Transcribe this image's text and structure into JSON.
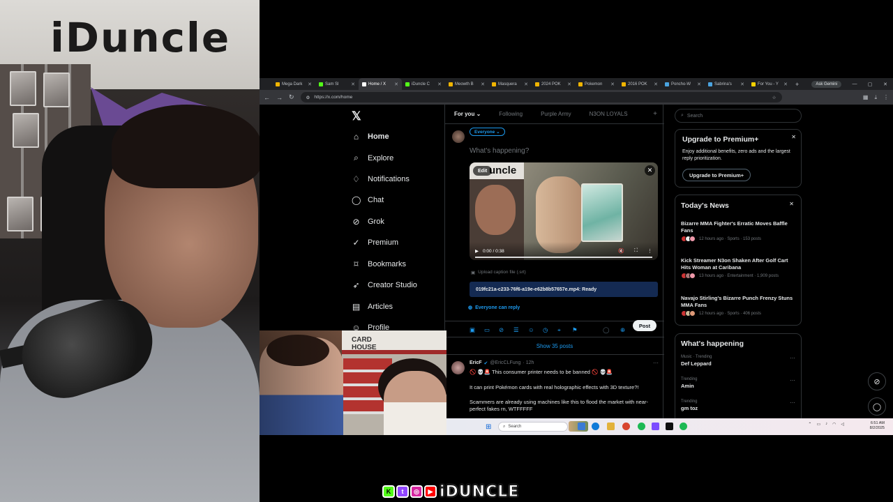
{
  "webcam": {
    "sign_text": "iDuncle"
  },
  "browser": {
    "tabs": [
      {
        "label": "Mega Dark",
        "color": "#f0b400"
      },
      {
        "label": "Sam Sl",
        "color": "#53fc18"
      },
      {
        "label": "Home / X",
        "color": "#ffffff",
        "active": true
      },
      {
        "label": "iDuncle C",
        "color": "#53fc18"
      },
      {
        "label": "Meowth B",
        "color": "#f0b400"
      },
      {
        "label": "Masquera",
        "color": "#f0b400"
      },
      {
        "label": "2024 POK",
        "color": "#f0b400"
      },
      {
        "label": "Pokemon",
        "color": "#f0b400"
      },
      {
        "label": "2016 POK",
        "color": "#f0b400"
      },
      {
        "label": "Poncho-W",
        "color": "#4aa3df"
      },
      {
        "label": "Sabrina's",
        "color": "#4aa3df"
      },
      {
        "label": "For You - Y",
        "color": "#f5d000"
      }
    ],
    "ask_gemini": "Ask Gemini",
    "url": "https://x.com/home"
  },
  "nav": {
    "items": [
      {
        "label": "Home",
        "icon": "home-icon",
        "glyph": "⌂"
      },
      {
        "label": "Explore",
        "icon": "search-icon",
        "glyph": "⌕"
      },
      {
        "label": "Notifications",
        "icon": "bell-icon",
        "glyph": "♢"
      },
      {
        "label": "Chat",
        "icon": "chat-icon",
        "glyph": "◯"
      },
      {
        "label": "Grok",
        "icon": "grok-icon",
        "glyph": "⊘"
      },
      {
        "label": "Premium",
        "icon": "premium-icon",
        "glyph": "✓"
      },
      {
        "label": "Bookmarks",
        "icon": "bookmark-icon",
        "glyph": "⌑"
      },
      {
        "label": "Creator Studio",
        "icon": "rocket-icon",
        "glyph": "➶"
      },
      {
        "label": "Articles",
        "icon": "article-icon",
        "glyph": "▤"
      },
      {
        "label": "Profile",
        "icon": "profile-icon",
        "glyph": "☺"
      }
    ]
  },
  "feed": {
    "tabs": [
      "For you",
      "Following",
      "Purple Army",
      "N3ON LOYALS"
    ],
    "audience": "Everyone",
    "placeholder": "What's happening?",
    "edit": "Edit",
    "video_time": "0:00 / 0:38",
    "caption": "Upload caption file (.srt)",
    "file_status": "019fc21a-c233-76f6-a19e-e62b8b57657e.mp4: Ready",
    "reply_setting": "Everyone can reply",
    "post_button": "Post",
    "show_posts": "Show 35 posts",
    "tweet": {
      "name": "EricF",
      "handle": "@EricCLFung",
      "time": "· 12h",
      "line1": "🚫 💀🚨 This consumer printer needs to be banned 🚫 💀🚨",
      "line2": "It can print Pokémon cards with real holographic effects with 3D texture?!",
      "line3": "Scammers are already using machines like this to flood the market with near-perfect fakes rn, WTFFFFF"
    }
  },
  "right": {
    "search_placeholder": "Search",
    "premium": {
      "title": "Upgrade to Premium+",
      "body": "Enjoy additional benefits, zero ads and the largest reply prioritization.",
      "button": "Upgrade to Premium+"
    },
    "news": {
      "title": "Today's News",
      "items": [
        {
          "headline": "Bizarre MMA Fighter's Erratic Moves Baffle Fans",
          "meta": "12 hours ago · Sports · 153 posts"
        },
        {
          "headline": "Kick Streamer N3on Shaken After Golf Cart Hits Woman at Caribana",
          "meta": "13 hours ago · Entertainment · 1,909 posts"
        },
        {
          "headline": "Navajo Stirling's Bizarre Punch Frenzy Stuns MMA Fans",
          "meta": "12 hours ago · Sports · 406 posts"
        }
      ]
    },
    "happening": {
      "title": "What's happening",
      "trends": [
        {
          "label": "Music · Trending",
          "name": "Def Leppard"
        },
        {
          "label": "Trending",
          "name": "Amin"
        },
        {
          "label": "Trending",
          "name": "gm toz"
        }
      ]
    }
  },
  "taskbar": {
    "search": "Search",
    "time": "6:51 AM",
    "date": "8/2/2025"
  },
  "overlay_cam": {
    "sign": "CARD HOUSE"
  },
  "brand": {
    "name": "iDUNCLE"
  }
}
